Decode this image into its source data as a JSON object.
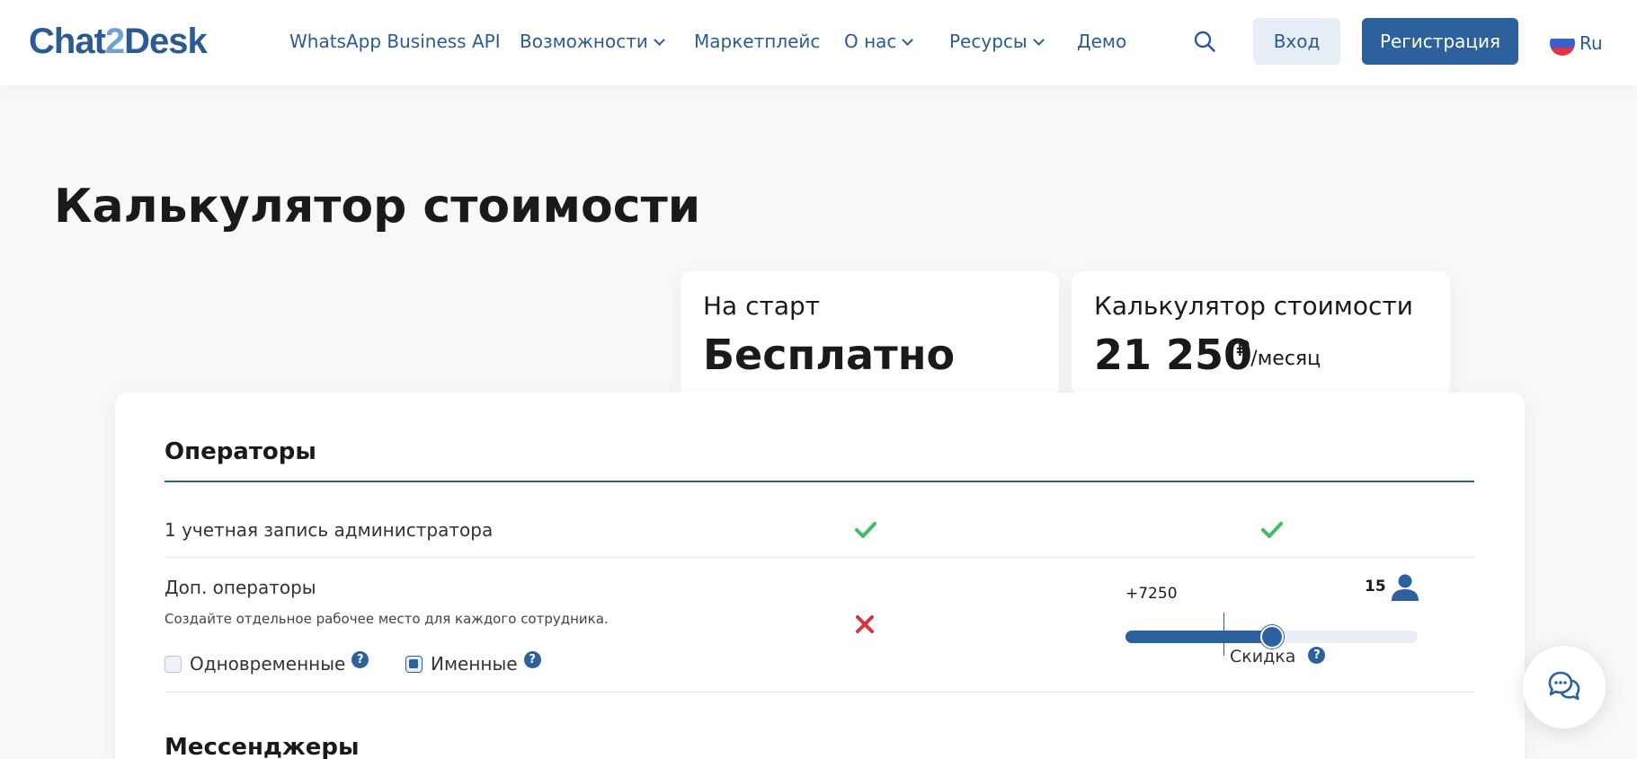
{
  "header": {
    "logo": {
      "part1": "Chat",
      "part2": "2",
      "part3": "Desk"
    },
    "nav": [
      {
        "label": "WhatsApp Business API",
        "has_dropdown": false
      },
      {
        "label": "Возможности",
        "has_dropdown": true
      },
      {
        "label": "Маркетплейс",
        "has_dropdown": false
      },
      {
        "label": "О нас",
        "has_dropdown": true
      },
      {
        "label": "Ресурсы",
        "has_dropdown": true
      },
      {
        "label": "Демо",
        "has_dropdown": false
      }
    ],
    "login_label": "Вход",
    "register_label": "Регистрация",
    "language": "Ru"
  },
  "page": {
    "title": "Калькулятор стоимости"
  },
  "plans": [
    {
      "name": "На старт",
      "price": "Бесплатно"
    },
    {
      "name": "Калькулятор стоимости",
      "price": "21 250",
      "currency": "₽",
      "period": "/месяц"
    }
  ],
  "calculator": {
    "operators_section": {
      "title": "Операторы",
      "admin_row": {
        "label": "1 учетная запись администратора",
        "free_included": true,
        "paid_included": true
      },
      "extra_row": {
        "label": "Доп. операторы",
        "description": "Создайте отдельное рабочее место для каждого сотрудника.",
        "free_included": false,
        "options": [
          {
            "label": "Одновременные",
            "checked": false,
            "help": "?"
          },
          {
            "label": "Именные",
            "checked": true,
            "help": "?"
          }
        ],
        "slider": {
          "extra_price": "+7250",
          "count": "15",
          "value_fraction": 0.5,
          "discount_mark_fraction": 0.335,
          "discount_label": "Скидка",
          "discount_help": "?"
        }
      }
    },
    "messengers_section": {
      "title": "Мессенджеры"
    }
  },
  "colors": {
    "brand": "#2d619e",
    "brand_light": "#6fa1d6",
    "check": "#3cc15a",
    "cross": "#d9343e"
  },
  "icons": {
    "search": "search-icon",
    "check": "check-icon",
    "cross": "cross-icon",
    "user": "user-icon",
    "chat": "chat-bubbles-icon"
  }
}
